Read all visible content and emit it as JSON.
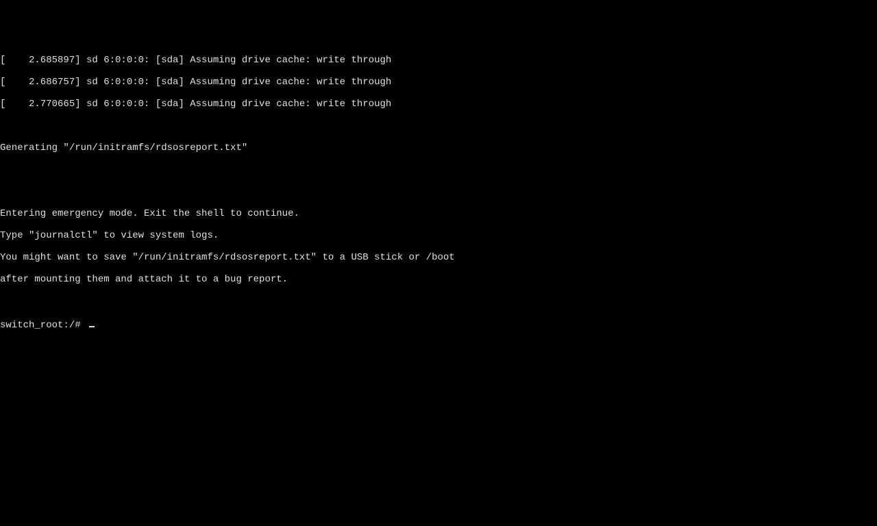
{
  "boot": {
    "lines": [
      "[    2.685897] sd 6:0:0:0: [sda] Assuming drive cache: write through",
      "[    2.686757] sd 6:0:0:0: [sda] Assuming drive cache: write through",
      "[    2.770665] sd 6:0:0:0: [sda] Assuming drive cache: write through"
    ]
  },
  "generating": "Generating \"/run/initramfs/rdsosreport.txt\"",
  "emergency": {
    "lines": [
      "Entering emergency mode. Exit the shell to continue.",
      "Type \"journalctl\" to view system logs.",
      "You might want to save \"/run/initramfs/rdsosreport.txt\" to a USB stick or /boot",
      "after mounting them and attach it to a bug report."
    ]
  },
  "prompt": "switch_root:/# "
}
